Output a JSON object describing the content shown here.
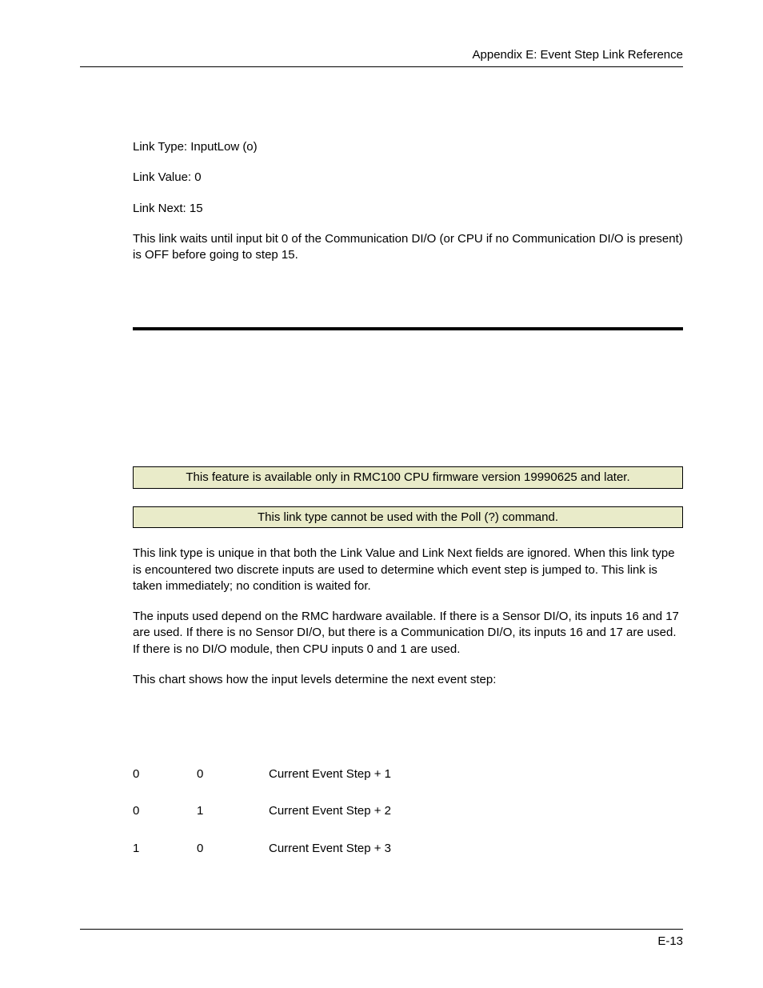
{
  "header": {
    "text": "Appendix E:  Event Step Link Reference"
  },
  "example": {
    "link_type": "Link Type: InputLow (o)",
    "link_value": "Link Value: 0",
    "link_next": "Link Next: 15",
    "description": "This link waits until input bit 0 of the Communication DI/O (or CPU if no Communication DI/O is present) is OFF before going to step 15."
  },
  "notes": {
    "firmware": "This feature is available only in RMC100 CPU firmware version 19990625 and later.",
    "poll": "This link type cannot be used with the Poll (?) command."
  },
  "body": {
    "p1": "This link type is unique in that both the Link Value and Link Next fields are ignored. When this link type is encountered two discrete inputs are used to determine which event step is jumped to. This link is taken immediately; no condition is waited for.",
    "p2": "The inputs used depend on the RMC hardware available. If there is a Sensor DI/O, its inputs 16 and 17 are used. If there is no Sensor DI/O, but there is a Communication DI/O, its inputs 16 and 17 are used. If there is no DI/O module, then CPU inputs 0 and 1 are used.",
    "chart_intro": "This chart shows how the input levels determine the next event step:"
  },
  "chart": {
    "rows": [
      {
        "a": "0",
        "b": "0",
        "c": "Current Event Step + 1"
      },
      {
        "a": "0",
        "b": "1",
        "c": "Current Event Step + 2"
      },
      {
        "a": "1",
        "b": "0",
        "c": "Current Event Step + 3"
      }
    ]
  },
  "footer": {
    "page": "E-13"
  }
}
